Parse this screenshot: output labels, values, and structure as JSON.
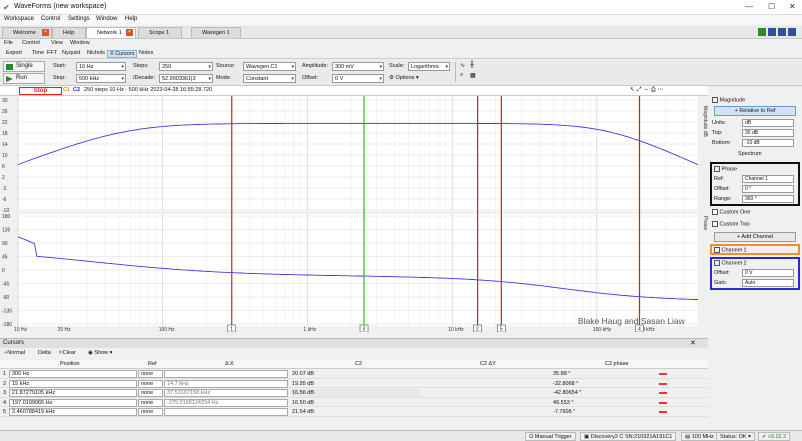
{
  "app": {
    "title": "WaveForms (new workspace)"
  },
  "menubar": [
    "Workspace",
    "Control",
    "Settings",
    "Window",
    "Help"
  ],
  "tabs": [
    {
      "label": "Welcome"
    },
    {
      "label": "Help"
    },
    {
      "label": "Network 1"
    },
    {
      "label": "Scope 1"
    },
    {
      "label": "Wavegen 1"
    }
  ],
  "submenu": [
    "File",
    "Control",
    "View",
    "Window"
  ],
  "subtabs": [
    "Export",
    "Time",
    "FFT",
    "Nyquist",
    "Nichols",
    "X Cursors",
    "Notes"
  ],
  "toolbar": {
    "single": "Single",
    "run": "Run",
    "start_label": "Start:",
    "start_value": "10 Hz",
    "stop_label": "Stop:",
    "stop_value": "500 kHz",
    "steps_label": "Steps:",
    "steps_value": "250",
    "decade_label": "/Decade:",
    "decade_value": "52.9903361|3",
    "source_label": "Source:",
    "source_value": "Wavegen C1",
    "mode_label": "Mode:",
    "mode_value": "Constant",
    "amplitude_label": "Amplitude:",
    "amplitude_value": "300 mV",
    "offset_label": "Offset:",
    "offset_value": "0 V",
    "scale_label": "Scale:",
    "scale_value": "Logarithmic",
    "options_label": "Options"
  },
  "status": {
    "stop": "Stop",
    "c1": "C1",
    "c2": "C2",
    "info": "250 steps  10 Hz - 500 kHz  2023-04-28 16:55:28.720"
  },
  "plot_top": {
    "y_ticks": [
      "30",
      "26",
      "22",
      "18",
      "14",
      "10",
      "6",
      "2",
      "-2",
      "-6",
      "-10"
    ],
    "side_label": "Magnitude dB"
  },
  "plot_bottom": {
    "y_ticks": [
      "180",
      "135",
      "90",
      "45",
      "0",
      "-45",
      "-90",
      "-135",
      "-180"
    ],
    "side_label": "Phase"
  },
  "x_ticks": [
    "10 Hz",
    "20 Hz",
    "100 Hz",
    "1 kHz",
    "10 kHz",
    "100 kHz",
    "200 kHz"
  ],
  "cursor_markers": [
    "4",
    "1",
    "3",
    "2",
    "5"
  ],
  "x_cursor_freqs_hz": [
    300,
    15000,
    21872.79105,
    197019.9065,
    2460.788419
  ],
  "right_panel": {
    "magnitude_label": "Magnitude",
    "relative_ref": "Relative to Ref",
    "units_label": "Units:",
    "units_value": "dB",
    "top_label": "Top:",
    "top_value": "30 dB",
    "bottom_label": "Bottom:",
    "bottom_value": "-10 dB",
    "spectrum_label": "Spectrum",
    "phase_label": "Phase",
    "ref_label": "Ref:",
    "ref_value": "Channel 1",
    "phase_offset_label": "Offset:",
    "phase_offset_value": "0 °",
    "range_label": "Range:",
    "range_value": "360 °",
    "custom_one": "Custom One",
    "custom_two": "Custom Two",
    "add_channel": "Add Channel",
    "channel1": "Channel 1",
    "channel2": "Channel 2",
    "ch2_offset_label": "Offset:",
    "ch2_offset_value": "0 V",
    "ch2_gain_label": "Gain:",
    "ch2_gain_value": "Auto",
    "colors": {
      "channel1_box": "#f09020",
      "channel2_box": "#2a2ad0",
      "phase_box": "#111111"
    }
  },
  "watermark": "Blake Haug and Sasan Liaw",
  "cursors": {
    "title": "Cursors",
    "normal": "Normal",
    "delta": "Delta",
    "clear": "Clear",
    "show": "Show",
    "headers": [
      "Position",
      "Ref",
      "Δ X",
      "C2",
      "C2 ΔY",
      "C2 phase"
    ],
    "rows": [
      {
        "n": "1",
        "position": "300 Hz",
        "ref": "none",
        "dx": "",
        "c2": "20.07 dB",
        "c2dy": "",
        "phase": "35.88 °"
      },
      {
        "n": "2",
        "position": "15 kHz",
        "ref": "none",
        "dx": "14.7 kHz",
        "c2": "19.95 dB",
        "c2dy": "",
        "phase": "-32.8068 °"
      },
      {
        "n": "3",
        "position": "21.87279105 kHz",
        "ref": "none",
        "dx": "37.53167158 kHz",
        "c2": "16.56 dB",
        "c2dy": "",
        "phase": "-42.80654 °"
      },
      {
        "n": "4",
        "position": "197.0199065 Hz",
        "ref": "none",
        "dx": "-275.0198124234 Hz",
        "c2": "16.50 dB",
        "c2dy": "",
        "phase": "49.553 °"
      },
      {
        "n": "5",
        "position": "2.460788419 kHz",
        "ref": "none",
        "dx": "",
        "c2": "21.54 dB",
        "c2dy": "",
        "phase": "-7.7606 °"
      }
    ]
  },
  "bottombar": {
    "manual_trigger": "Manual Trigger",
    "device": "Discovery2 C SN:210321A191C1",
    "rate": "100 MHz",
    "status": "Status: OK",
    "version": "v3.22.2"
  }
}
